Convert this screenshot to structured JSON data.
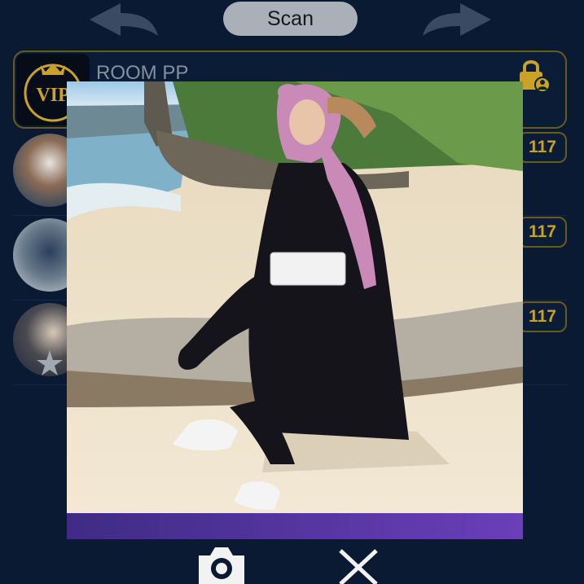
{
  "toolbar": {
    "scan_label": "Scan",
    "back_icon": "back-arrow-icon",
    "forward_icon": "forward-arrow-icon"
  },
  "room": {
    "title": "ROOM PP",
    "logo_text": "VIP",
    "lock_icon": "lock-user-icon"
  },
  "list": [
    {
      "count": "117"
    },
    {
      "count": "117"
    },
    {
      "count": "117"
    }
  ],
  "bottom_bar": {
    "camera_icon": "camera-icon",
    "close_icon": "close-icon"
  },
  "colors": {
    "background": "#0a1a33",
    "accent_gold": "#c9a227",
    "frame_purple": "#5a3d9e"
  }
}
